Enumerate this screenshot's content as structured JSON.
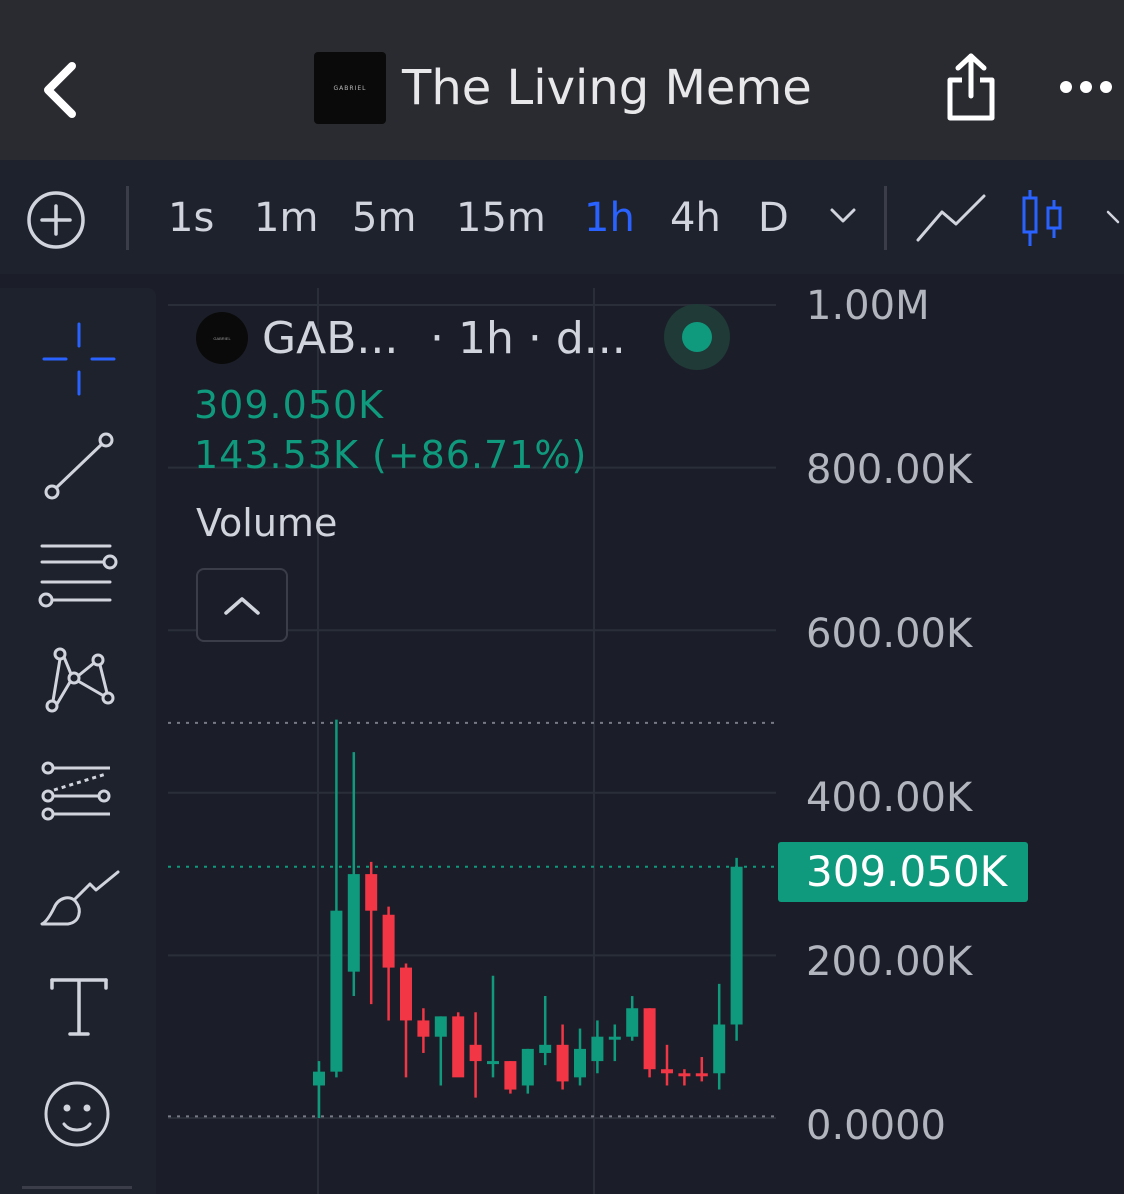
{
  "header": {
    "title": "The Living Meme",
    "logo_text": "GABRIEL"
  },
  "toolbar": {
    "timeframes": [
      "1s",
      "1m",
      "5m",
      "15m",
      "1h",
      "4h",
      "D"
    ],
    "active_timeframe": "1h"
  },
  "legend": {
    "symbol": "GAB...",
    "interval": "· 1h · d...",
    "price": "309.050K",
    "change": "143.53K (+86.71%)",
    "indicator": "Volume",
    "status": "open"
  },
  "y_axis": {
    "labels": [
      "1.00M",
      "800.00K",
      "600.00K",
      "400.00K",
      "200.00K",
      "0.0000"
    ]
  },
  "last_price_tag": "309.050K",
  "colors": {
    "up": "#0f9a7d",
    "down": "#f23645",
    "accent": "#2962ff",
    "background": "#1b1e28",
    "panel": "#1e222d",
    "header": "#2a2b30"
  },
  "chart_data": {
    "type": "candlestick",
    "interval": "1h",
    "ylim": [
      0,
      1000000
    ],
    "reference_lines": [
      486000,
      309050,
      2000
    ],
    "candles": [
      {
        "open": 40000,
        "high": 70000,
        "low": 0,
        "close": 57000
      },
      {
        "open": 57000,
        "high": 490000,
        "low": 50000,
        "close": 255000
      },
      {
        "open": 180000,
        "high": 450000,
        "low": 150000,
        "close": 300000
      },
      {
        "open": 300000,
        "high": 315000,
        "low": 140000,
        "close": 255000
      },
      {
        "open": 250000,
        "high": 260000,
        "low": 120000,
        "close": 185000
      },
      {
        "open": 185000,
        "high": 190000,
        "low": 50000,
        "close": 120000
      },
      {
        "open": 120000,
        "high": 135000,
        "low": 80000,
        "close": 100000
      },
      {
        "open": 100000,
        "high": 125000,
        "low": 40000,
        "close": 125000
      },
      {
        "open": 125000,
        "high": 130000,
        "low": 90000,
        "close": 50000
      },
      {
        "open": 90000,
        "high": 130000,
        "low": 25000,
        "close": 70000
      },
      {
        "open": 70000,
        "high": 175000,
        "low": 50000,
        "close": 70000
      },
      {
        "open": 70000,
        "high": 70000,
        "low": 30000,
        "close": 35000
      },
      {
        "open": 40000,
        "high": 85000,
        "low": 30000,
        "close": 85000
      },
      {
        "open": 80000,
        "high": 150000,
        "low": 65000,
        "close": 90000
      },
      {
        "open": 90000,
        "high": 115000,
        "low": 35000,
        "close": 45000
      },
      {
        "open": 50000,
        "high": 110000,
        "low": 40000,
        "close": 85000
      },
      {
        "open": 70000,
        "high": 120000,
        "low": 55000,
        "close": 100000
      },
      {
        "open": 100000,
        "high": 115000,
        "low": 70000,
        "close": 100000
      },
      {
        "open": 100000,
        "high": 150000,
        "low": 95000,
        "close": 135000
      },
      {
        "open": 135000,
        "high": 135000,
        "low": 50000,
        "close": 60000
      },
      {
        "open": 60000,
        "high": 90000,
        "low": 40000,
        "close": 55000
      },
      {
        "open": 55000,
        "high": 60000,
        "low": 40000,
        "close": 53000
      },
      {
        "open": 55000,
        "high": 75000,
        "low": 45000,
        "close": 53000
      },
      {
        "open": 55000,
        "high": 165000,
        "low": 35000,
        "close": 115000
      },
      {
        "open": 115000,
        "high": 320000,
        "low": 95000,
        "close": 309050
      }
    ]
  }
}
